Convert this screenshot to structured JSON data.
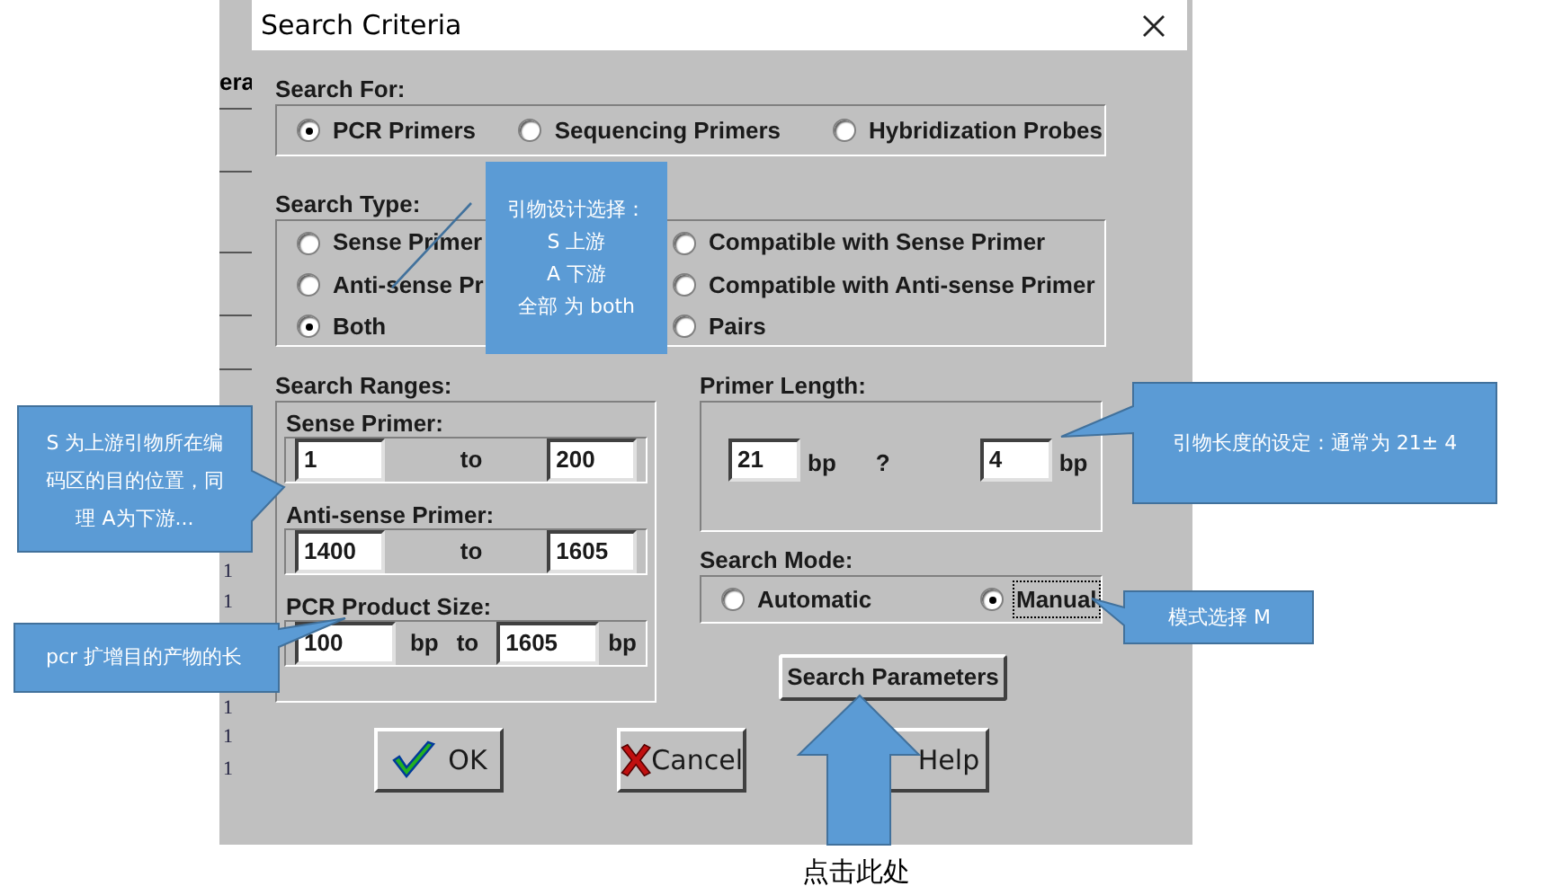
{
  "background_window": {
    "fragment": "era",
    "row_marks": [
      "1",
      "1",
      "1",
      "1",
      "1"
    ]
  },
  "dialog": {
    "title": "Search Criteria",
    "search_for": {
      "label": "Search For:",
      "options": [
        {
          "label": "PCR Primers",
          "selected": true
        },
        {
          "label": "Sequencing Primers",
          "selected": false
        },
        {
          "label": "Hybridization Probes",
          "selected": false
        }
      ]
    },
    "search_type": {
      "label": "Search Type:",
      "options": [
        {
          "label": "Sense Primer",
          "selected": false
        },
        {
          "label": "Anti-sense Pr",
          "selected": false
        },
        {
          "label": "Both",
          "selected": true
        },
        {
          "label": "Compatible with Sense Primer",
          "selected": false
        },
        {
          "label": "Compatible with Anti-sense Primer",
          "selected": false
        },
        {
          "label": "Pairs",
          "selected": false
        }
      ]
    },
    "search_ranges": {
      "label": "Search Ranges:",
      "groups": [
        {
          "label": "Sense Primer:",
          "from": "1",
          "to_label": "to",
          "to": "200"
        },
        {
          "label": "Anti-sense Primer:",
          "from": "1400",
          "to_label": "to",
          "to": "1605"
        },
        {
          "label": "PCR Product Size:",
          "from": "100",
          "from_unit": "bp",
          "to_label": "to",
          "to": "1605",
          "to_unit": "bp"
        }
      ]
    },
    "primer_length": {
      "label": "Primer Length:",
      "value": "21",
      "unit": "bp",
      "separator": "?",
      "tolerance": "4",
      "tolerance_unit": "bp"
    },
    "search_mode": {
      "label": "Search Mode:",
      "options": [
        {
          "label": "Automatic",
          "selected": false,
          "focused": false
        },
        {
          "label": "Manual",
          "selected": true,
          "focused": true
        }
      ]
    },
    "search_parameters_button": "Search Parameters",
    "buttons": [
      {
        "kind": "ok",
        "label": "OK"
      },
      {
        "kind": "cancel",
        "label": "Cancel"
      },
      {
        "kind": "help",
        "label": "Help"
      }
    ]
  },
  "annotations": [
    {
      "lines": [
        "引物设计选择：",
        "S 上游",
        "A 下游",
        "全部 为 both"
      ]
    },
    {
      "lines": [
        "S 为上游引物所在编",
        "码区的目的位置，同",
        "理 A为下游..."
      ]
    },
    {
      "text": "pcr 扩增目的产物的长"
    },
    {
      "text": "引物长度的设定：通常为 21± 4"
    },
    {
      "text": "模式选择 M"
    }
  ],
  "arrow_caption": "点击此处"
}
